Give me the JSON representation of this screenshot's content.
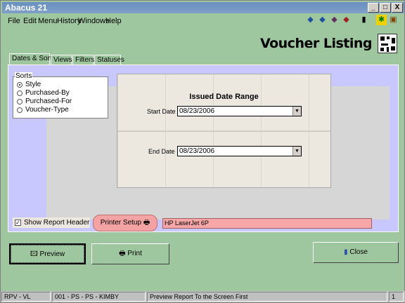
{
  "window": {
    "title": "Abacus 21",
    "controls": [
      "_",
      "□",
      "X"
    ]
  },
  "menu": [
    "File",
    "Edit",
    "Menu",
    "History",
    "Windows",
    "Help"
  ],
  "toolbar_icons": [
    "back-arrow-icon",
    "forward-arrow-icon",
    "home-icon",
    "search-icon",
    "calculator-icon",
    "help-icon",
    "exit-icon"
  ],
  "heading": "Voucher Listing",
  "tabs": [
    {
      "label": "Dates & Sorts"
    },
    {
      "label": "Views"
    },
    {
      "label": "Filters"
    },
    {
      "label": "Statuses"
    }
  ],
  "sorts": {
    "legend": "Sorts",
    "options": [
      {
        "label": "Style",
        "selected": true
      },
      {
        "label": "Purchased-By",
        "selected": false
      },
      {
        "label": "Purchased-For",
        "selected": false
      },
      {
        "label": "Voucher-Type",
        "selected": false
      }
    ]
  },
  "date_range": {
    "title": "Issued Date Range",
    "start_label": "Start Date",
    "start_value": "08/23/2006",
    "end_label": "End Date",
    "end_value": "08/23/2006"
  },
  "report_header": {
    "label": "Show Report Header",
    "checked": true
  },
  "printer_setup": {
    "label": "Printer Setup"
  },
  "printer_name": "HP LaserJet 6P",
  "buttons": {
    "preview": "Preview",
    "print": "Print",
    "close": "Close"
  },
  "statusbar": [
    "RPV - VL",
    "001 - PS - PS - KIMBY",
    "Preview Report To the Screen First",
    "1"
  ]
}
